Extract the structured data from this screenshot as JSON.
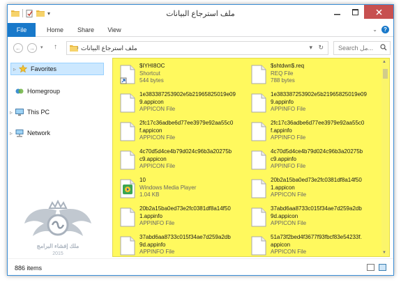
{
  "window": {
    "title": "ملف استرجاع البيانات"
  },
  "ribbon": {
    "tabs": [
      "File",
      "Home",
      "Share",
      "View"
    ]
  },
  "address": {
    "path": "ملف استرجاع البيانات",
    "search_placeholder": "Search مل..."
  },
  "nav": {
    "items": [
      {
        "label": "Favorites",
        "icon": "star-icon"
      },
      {
        "label": "Homegroup",
        "icon": "homegroup-icon"
      },
      {
        "label": "This PC",
        "icon": "computer-icon"
      },
      {
        "label": "Network",
        "icon": "network-icon"
      }
    ]
  },
  "logo": {
    "text": "ملك إفشاء البرامج",
    "year": "2015"
  },
  "files": [
    {
      "line1": "$IYHI8OC",
      "line2": "",
      "type": "Shortcut",
      "size": "544 bytes",
      "icon": "shortcut-file-icon"
    },
    {
      "line1": "$shtdwn$.req",
      "line2": "",
      "type": "REQ File",
      "size": "788 bytes",
      "icon": "req-file-icon"
    },
    {
      "line1": "1e383387253902e5b21965825019e09",
      "line2": "9.appicon",
      "type": "APPICON File",
      "size": "",
      "icon": "appicon-file-icon"
    },
    {
      "line1": "1e383387253902e5b21965825019e09",
      "line2": "9.appinfo",
      "type": "APPINFO File",
      "size": "",
      "icon": "appinfo-file-icon"
    },
    {
      "line1": "2fc17c36adbe6d77ee3979e92aa55c0",
      "line2": "f.appicon",
      "type": "APPICON File",
      "size": "",
      "icon": "appicon-file-icon"
    },
    {
      "line1": "2fc17c36adbe6d77ee3979e92aa55c0",
      "line2": "f.appinfo",
      "type": "APPINFO File",
      "size": "",
      "icon": "appinfo-file-icon"
    },
    {
      "line1": "4c70d5d4ce4b79d024c96b3a20275b",
      "line2": "c9.appicon",
      "type": "APPICON File",
      "size": "",
      "icon": "appicon-file-icon"
    },
    {
      "line1": "4c70d5d4ce4b79d024c96b3a20275b",
      "line2": "c9.appinfo",
      "type": "APPINFO File",
      "size": "",
      "icon": "appinfo-file-icon"
    },
    {
      "line1": "10",
      "line2": "",
      "type": "Windows Media Player",
      "size": "1.04 KB",
      "icon": "media-player-file-icon"
    },
    {
      "line1": "20b2a15ba0ed73e2fc0381df8a14f50",
      "line2": "1.appicon",
      "type": "APPICON File",
      "size": "",
      "icon": "appicon-file-icon"
    },
    {
      "line1": "20b2a15ba0ed73e2fc0381df8a14f50",
      "line2": "1.appinfo",
      "type": "APPINFO File",
      "size": "",
      "icon": "appinfo-file-icon"
    },
    {
      "line1": "37abd6aa8733c015f34ae7d259a2db",
      "line2": "9d.appicon",
      "type": "APPICON File",
      "size": "",
      "icon": "appicon-file-icon"
    },
    {
      "line1": "37abd6aa8733c015f34ae7d259a2db",
      "line2": "9d.appinfo",
      "type": "APPINFO File",
      "size": "",
      "icon": "appinfo-file-icon"
    },
    {
      "line1": "51a73f2bed4f3677f93fbcf83e54233f.",
      "line2": "appicon",
      "type": "APPICON File",
      "size": "",
      "icon": "appicon-file-icon"
    }
  ],
  "status": {
    "count": "886 items"
  }
}
